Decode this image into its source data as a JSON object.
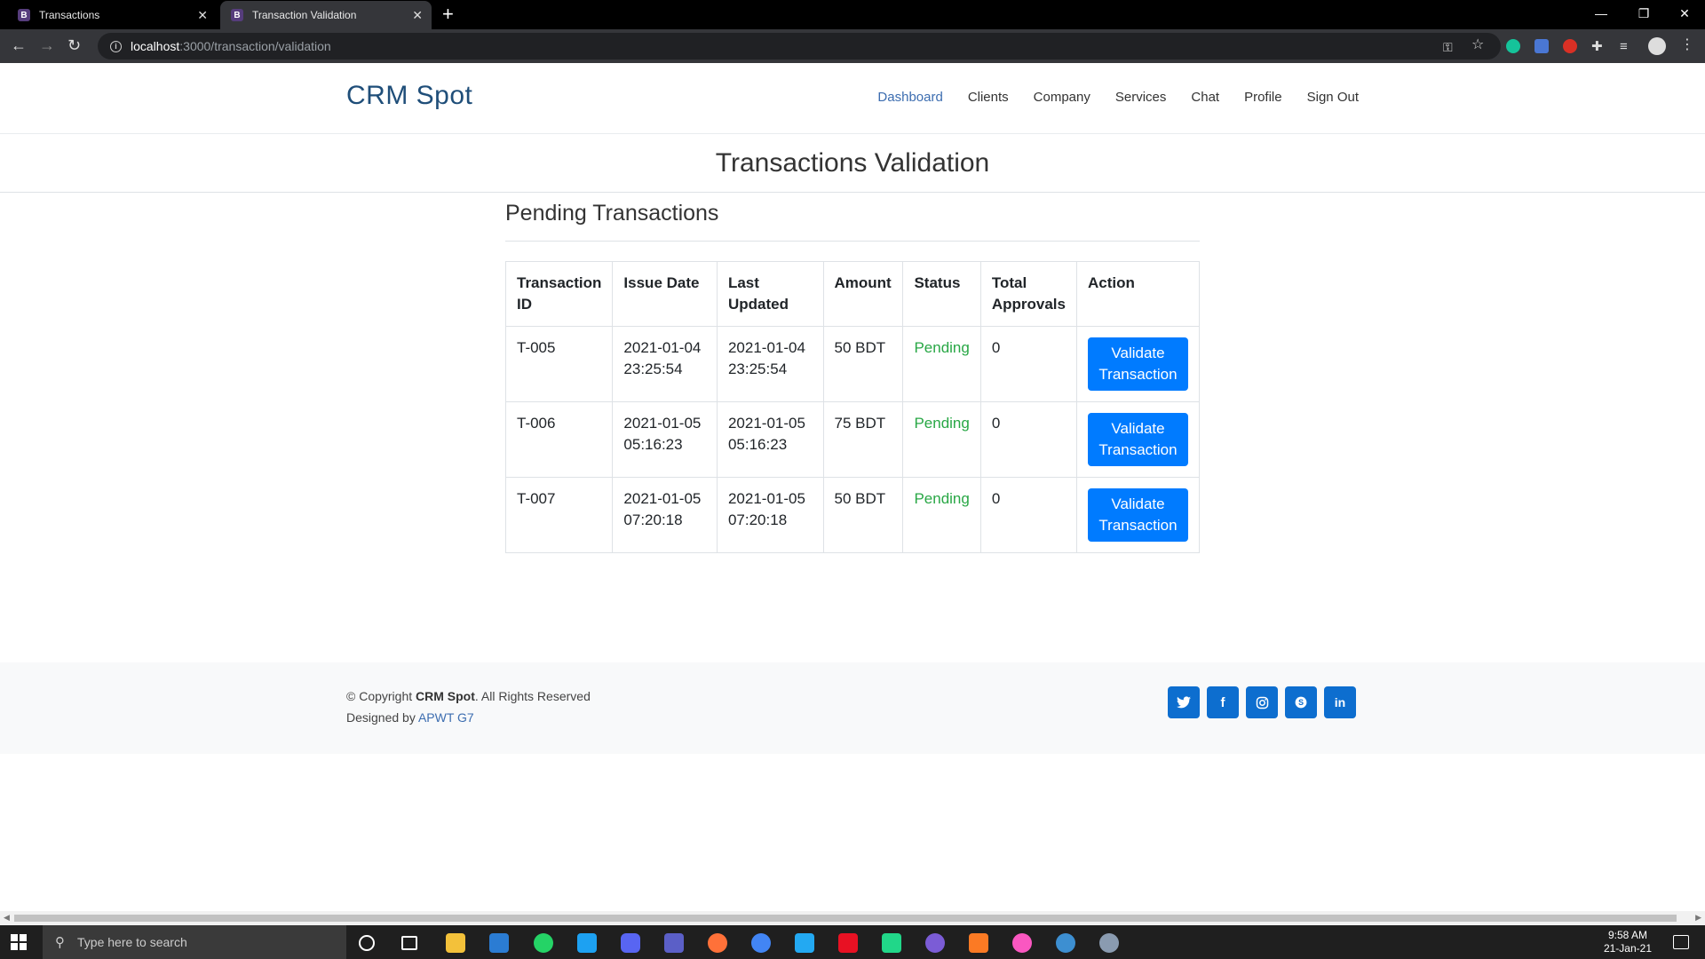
{
  "browser": {
    "tabs": [
      {
        "favicon": "B",
        "label": "Transactions"
      },
      {
        "favicon": "B",
        "label": "Transaction Validation"
      }
    ],
    "url_host": "localhost",
    "url_path": ":3000/transaction/validation"
  },
  "site": {
    "brand": "CRM Spot",
    "nav": [
      "Dashboard",
      "Clients",
      "Company",
      "Services",
      "Chat",
      "Profile",
      "Sign Out"
    ]
  },
  "page_title": "Transactions Validation",
  "section_title": "Pending Transactions",
  "table": {
    "headers": [
      "Transaction ID",
      "Issue Date",
      "Last Updated",
      "Amount",
      "Status",
      "Total Approvals",
      "Action"
    ],
    "rows": [
      {
        "id": "T-005",
        "issue_date": "2021-01-04",
        "issue_time": "23:25:54",
        "updated_date": "2021-01-04",
        "updated_time": "23:25:54",
        "amount": "50 BDT",
        "status": "Pending",
        "approvals": "0",
        "action": "Validate Transaction"
      },
      {
        "id": "T-006",
        "issue_date": "2021-01-05",
        "issue_time": "05:16:23",
        "updated_date": "2021-01-05",
        "updated_time": "05:16:23",
        "amount": "75 BDT",
        "status": "Pending",
        "approvals": "0",
        "action": "Validate Transaction"
      },
      {
        "id": "T-007",
        "issue_date": "2021-01-05",
        "issue_time": "07:20:18",
        "updated_date": "2021-01-05",
        "updated_time": "07:20:18",
        "amount": "50 BDT",
        "status": "Pending",
        "approvals": "0",
        "action": "Validate Transaction"
      }
    ]
  },
  "footer": {
    "copyright_prefix": "© Copyright ",
    "company": "CRM Spot",
    "rights": ". All Rights Reserved",
    "designed_by": "Designed by ",
    "designer": "APWT G7",
    "socials": [
      "twitter-icon",
      "facebook-icon",
      "instagram-icon",
      "skype-icon",
      "linkedin-icon"
    ]
  },
  "taskbar": {
    "search_placeholder": "Type here to search",
    "time": "9:58 AM",
    "date": "21-Jan-21"
  },
  "colors": {
    "brand": "#1f4e79",
    "link": "#3c6db0",
    "primary_button": "#007bff",
    "status_pending": "#28a745",
    "social_button": "#0d6ecf"
  }
}
